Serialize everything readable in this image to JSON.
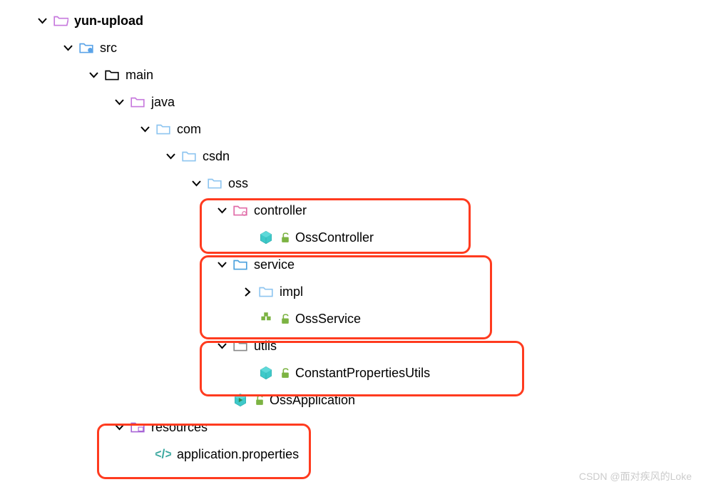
{
  "tree": {
    "root": "yun-upload",
    "src": "src",
    "main": "main",
    "java": "java",
    "com": "com",
    "csdn": "csdn",
    "oss": "oss",
    "controller": "controller",
    "ossController": "OssController",
    "service": "service",
    "impl": "impl",
    "ossService": "OssService",
    "utils": "utils",
    "constantPropertiesUtils": "ConstantPropertiesUtils",
    "ossApplication": "OssApplication",
    "resources": "resources",
    "applicationProperties": "application.properties"
  },
  "watermark": "CSDN @面对疾风的Loke"
}
